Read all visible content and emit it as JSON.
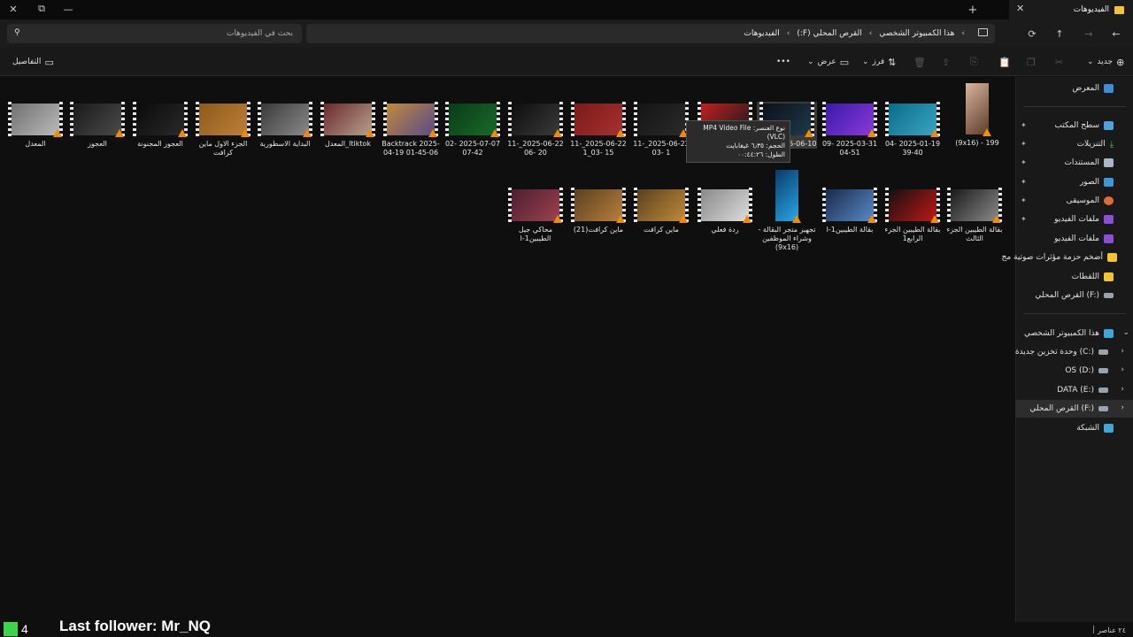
{
  "window": {
    "tab_title": "الفيديوهات",
    "close": "✕",
    "minimize": "—",
    "restore": "⧉",
    "new_tab": "+"
  },
  "nav": {
    "search_placeholder": "بحث في الفيديوهات",
    "breadcrumbs": [
      "هذا الكمبيوتر الشخصي",
      "القرص المحلي (F:)",
      "الفيديوهات"
    ]
  },
  "toolbar": {
    "new": "جديد",
    "sort": "فرز",
    "view": "عرض",
    "more": "•••",
    "details": "التفاصيل"
  },
  "sidebar": {
    "gallery": "المعرض",
    "pinned": [
      "سطح المكتب",
      "التنزيلات",
      "المستندات",
      "الصور",
      "الموسيقى",
      "ملفات الفيديو"
    ],
    "folders": [
      "ملفات الفيديو",
      "أضخم حزمة مؤثرات صوتية مج",
      "اللقطات",
      "القرص المحلي (F:)"
    ],
    "this_pc": "هذا الكمبيوتر الشخصي",
    "drives": [
      "وحدة تخزين جديدة (C:)",
      "OS (D:)",
      "DATA (E:)",
      "القرص المحلي (F:)"
    ],
    "network": "الشبكة"
  },
  "files_row1": [
    "199 - (9x16)",
    "2025-01-19 04-39-40",
    "2025-03-31 09-04-51",
    "2025-06-10 ...47",
    "...",
    "2025-06-22_11-1 -03",
    "2025-06-22_11-15 -03_1",
    "2025-06-22_11-20 -06",
    "2025-07-07 02-07-42",
    "Backtrack 2025-04-19 01-45-06",
    "tiktokا_المعدل",
    "البداية الاسطورية",
    "الجزء الاول ماين كرافت",
    "العجوز المجنونة",
    "العجوز",
    "المعدل"
  ],
  "files_row2": [
    "بقالة الطيبين الجزء الثالث",
    "بقالة الطيبين الجزء الرابع1",
    "بقالة الطيبين1-ا",
    "تجهيز متجر البقالة - وشراء الموظفين (9x16)",
    "ردة فعلي",
    "ماين كرافت",
    "ماين كرافت(21)",
    "محاكي جيل الطيبين1-ا"
  ],
  "tooltip": {
    "line1": "نوع العنصر: MP4 Video File (VLC)",
    "line2": "الحجم: ٦٫٣٥ غيغابايت",
    "line3": "الطول: ٠٠:٤٤:٢٦"
  },
  "status": {
    "count": "٢٤ عناصر",
    "follower": "Last follower: Mr_NQ",
    "app_badge": "4"
  }
}
